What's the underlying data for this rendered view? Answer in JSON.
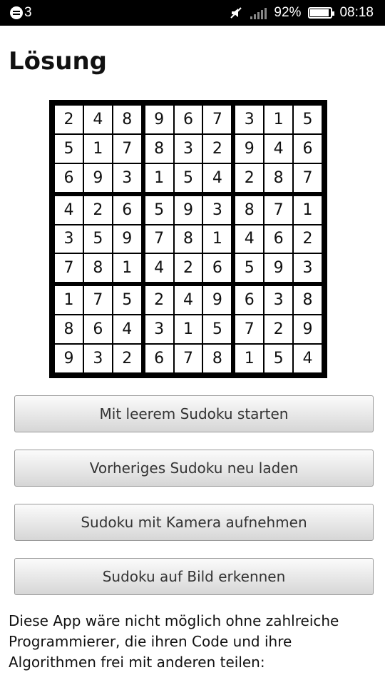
{
  "status_bar": {
    "notification_count": "3",
    "battery_percent": "92%",
    "battery_level": 0.92,
    "time": "08:18",
    "icons": [
      "notification-icon",
      "mute-icon",
      "signal-icon",
      "battery-icon"
    ]
  },
  "page": {
    "title": "Lösung"
  },
  "sudoku": {
    "rows": [
      [
        "2",
        "4",
        "8",
        "9",
        "6",
        "7",
        "3",
        "1",
        "5"
      ],
      [
        "5",
        "1",
        "7",
        "8",
        "3",
        "2",
        "9",
        "4",
        "6"
      ],
      [
        "6",
        "9",
        "3",
        "1",
        "5",
        "4",
        "2",
        "8",
        "7"
      ],
      [
        "4",
        "2",
        "6",
        "5",
        "9",
        "3",
        "8",
        "7",
        "1"
      ],
      [
        "3",
        "5",
        "9",
        "7",
        "8",
        "1",
        "4",
        "6",
        "2"
      ],
      [
        "7",
        "8",
        "1",
        "4",
        "2",
        "6",
        "5",
        "9",
        "3"
      ],
      [
        "1",
        "7",
        "5",
        "2",
        "4",
        "9",
        "6",
        "3",
        "8"
      ],
      [
        "8",
        "6",
        "4",
        "3",
        "1",
        "5",
        "7",
        "2",
        "9"
      ],
      [
        "9",
        "3",
        "2",
        "6",
        "7",
        "8",
        "1",
        "5",
        "4"
      ]
    ]
  },
  "buttons": {
    "empty_label": "Mit leerem Sudoku starten",
    "reload_label": "Vorheriges Sudoku neu laden",
    "camera_label": "Sudoku mit Kamera aufnehmen",
    "image_label": "Sudoku auf Bild erkennen"
  },
  "footer": {
    "text": "Diese App wäre nicht möglich ohne zahlreiche Programmierer, die ihren Code und ihre Algorithmen frei mit anderen teilen:"
  }
}
